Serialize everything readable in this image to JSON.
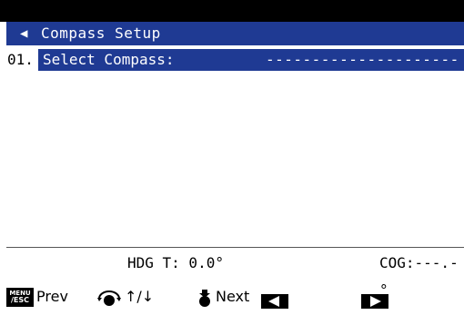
{
  "header": {
    "back_icon": "triangle-left-icon",
    "title": "Compass Setup"
  },
  "rows": [
    {
      "number": "01.",
      "label": "Select Compass:",
      "value": "----------------------",
      "selected": true
    }
  ],
  "status": {
    "hdg": "HDG T:  0.0°",
    "cog": "COG:---.-°"
  },
  "footer": {
    "menu_key_line1": "MENU",
    "menu_key_line2": "/ESC",
    "prev_label": "Prev",
    "knob_icon": "rotary-knob-icon",
    "arrows_label": "↑/↓",
    "push_icon": "knob-push-icon",
    "next_label": "Next",
    "left_key_icon": "left-arrow-key-icon",
    "right_key_icon": "right-arrow-key-icon"
  },
  "colors": {
    "highlight": "#1f3a93",
    "border": "#000000",
    "background": "#ffffff"
  }
}
